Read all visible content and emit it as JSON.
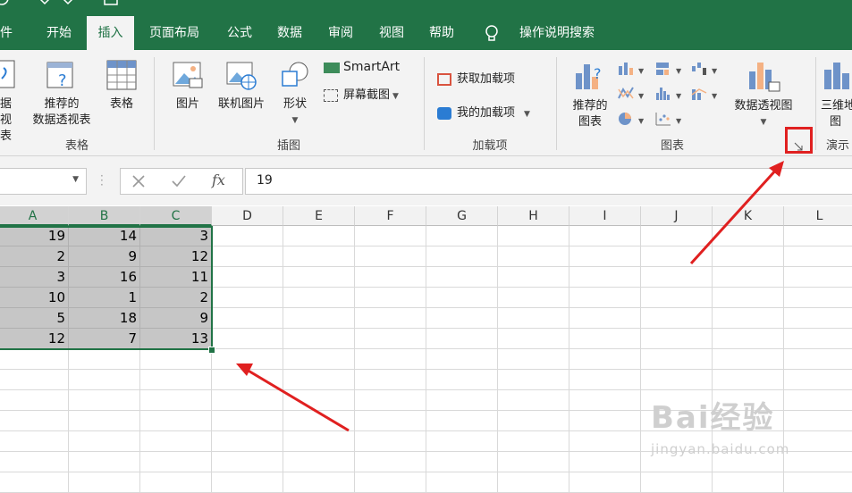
{
  "ribbon_tabs": [
    "件",
    "开始",
    "插入",
    "页面布局",
    "公式",
    "数据",
    "审阅",
    "视图",
    "帮助",
    "操作说明搜索"
  ],
  "groups": {
    "tables": {
      "label": "表格",
      "btn1a": "据",
      "btn1b": "视表",
      "btn2a": "推荐的",
      "btn2b": "数据透视表",
      "btn3": "表格"
    },
    "illustrations": {
      "label": "插图",
      "picture": "图片",
      "online": "联机图片",
      "shapes": "形状",
      "smartart": "SmartArt",
      "screenshot": "屏幕截图"
    },
    "addins": {
      "label": "加载项",
      "get": "获取加载项",
      "my": "我的加载项"
    },
    "charts": {
      "label": "图表",
      "rec_a": "推荐的",
      "rec_b": "图表",
      "pivot": "数据透视图"
    },
    "tours": {
      "label": "演示",
      "map_a": "三维地",
      "map_b": "图"
    }
  },
  "formula": {
    "fx": "fx",
    "value": "19"
  },
  "columns": [
    "A",
    "B",
    "C",
    "D",
    "E",
    "F",
    "G",
    "H",
    "I",
    "J",
    "K",
    "L"
  ],
  "rows": [
    [
      "19",
      "14",
      "3"
    ],
    [
      "2",
      "9",
      "12"
    ],
    [
      "3",
      "16",
      "11"
    ],
    [
      "10",
      "1",
      "2"
    ],
    [
      "5",
      "18",
      "9"
    ],
    [
      "12",
      "7",
      "13"
    ]
  ],
  "watermark": {
    "line1": "Bai经验",
    "line2": "jingyan.baidu.com"
  },
  "colors": {
    "brand": "#217346",
    "annotation": "#e02020"
  }
}
